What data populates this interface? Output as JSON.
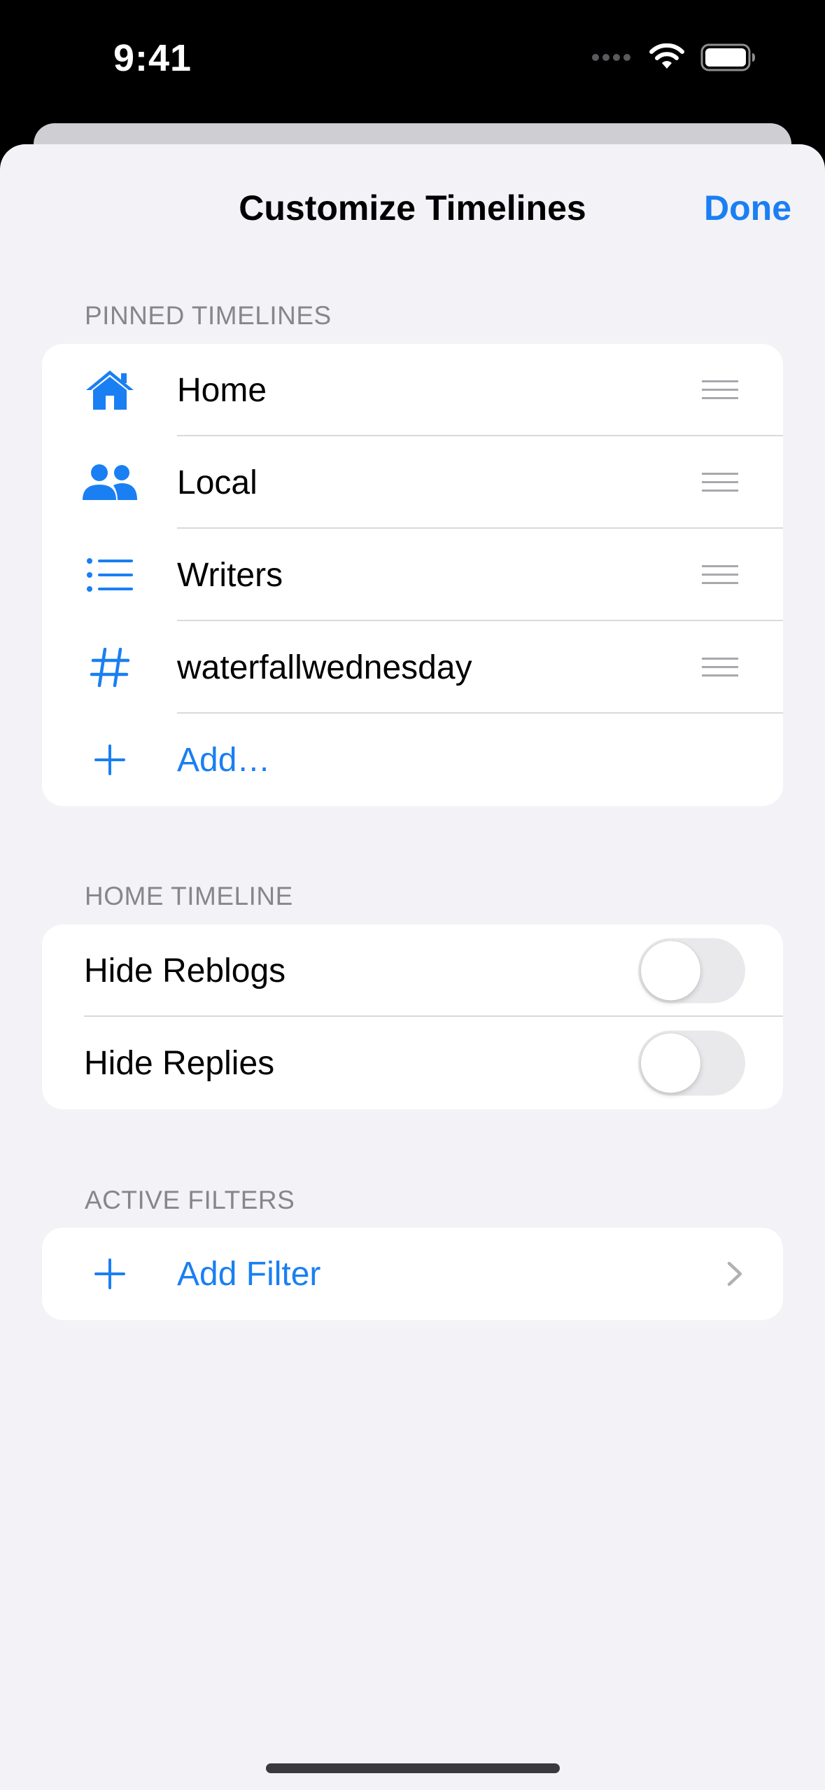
{
  "status_bar": {
    "time": "9:41"
  },
  "nav": {
    "title": "Customize Timelines",
    "done_label": "Done"
  },
  "pinned": {
    "header": "PINNED TIMELINES",
    "items": [
      {
        "label": "Home",
        "icon": "house-icon"
      },
      {
        "label": "Local",
        "icon": "people-icon"
      },
      {
        "label": "Writers",
        "icon": "list-icon"
      },
      {
        "label": "waterfallwednesday",
        "icon": "hashtag-icon"
      }
    ],
    "add_label": "Add…"
  },
  "home_timeline": {
    "header": "HOME TIMELINE",
    "toggles": [
      {
        "label": "Hide Reblogs",
        "on": false
      },
      {
        "label": "Hide Replies",
        "on": false
      }
    ]
  },
  "filters": {
    "header": "ACTIVE FILTERS",
    "add_label": "Add Filter"
  },
  "colors": {
    "accent": "#1a7ff2",
    "background": "#f2f2f7",
    "secondary_text": "#86868b"
  }
}
